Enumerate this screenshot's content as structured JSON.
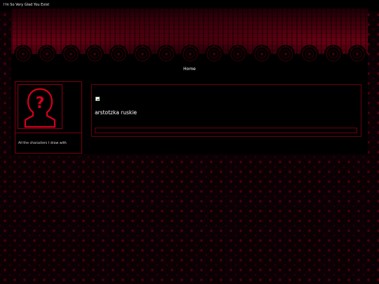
{
  "site": {
    "title": "I'm So Very Glad You Exist"
  },
  "nav": {
    "home_label": "Home"
  },
  "sidebar": {
    "avatar_icon": "default-avatar-icon",
    "caption": "All the characters I draw with"
  },
  "post": {
    "image_icon": "broken-image-icon",
    "title": "arstotzka ruskie"
  },
  "colors": {
    "background": "#0b0003",
    "accent_red": "#8a0012",
    "panel": "#000000",
    "text": "#ffffff"
  }
}
